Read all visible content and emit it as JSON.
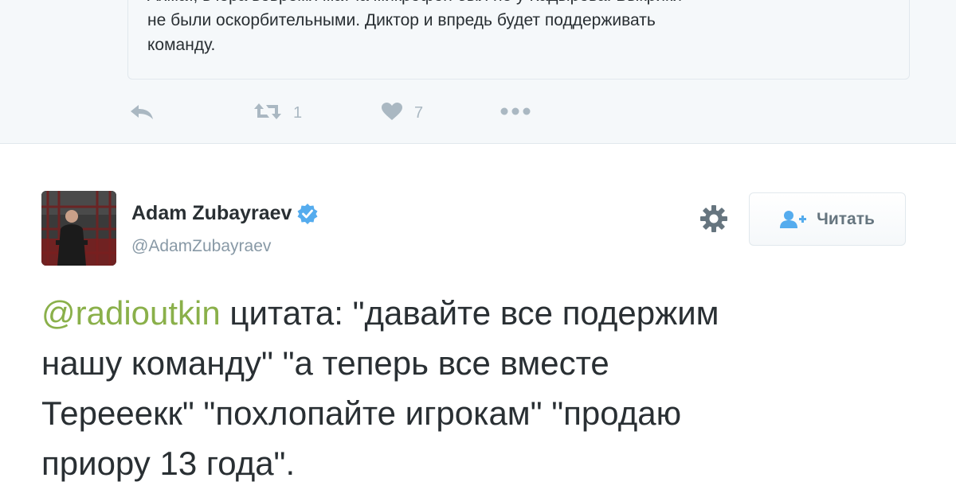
{
  "quoted": {
    "line1": "Ахмат, вчера вовремя матча микрофон был не у Кадырова. Выкрики",
    "line2": "не были оскорбительными. Диктор и впредь будет поддерживать",
    "line3": "команду.",
    "actions": {
      "reply_icon": "reply-icon",
      "retweet_icon": "retweet-icon",
      "retweet_count": "1",
      "like_icon": "heart-icon",
      "like_count": "7",
      "more_icon": "more-icon"
    }
  },
  "tweet": {
    "author_name": "Adam Zubayraev",
    "verified": true,
    "handle": "@AdamZubayraev",
    "follow_label": "Читать",
    "mention": "@radioutkin",
    "line1_rest": " цитата: \"давайте все подержим",
    "line2": "нашу команду\" \"а теперь все вместе",
    "line3": "Терееекк\" \"похлопайте игрокам\" \"продаю",
    "line4": "приору 13 года\"."
  },
  "colors": {
    "mention": "#8ab04a",
    "verified": "#55acee",
    "text": "#292f33",
    "muted": "#8899a6",
    "action": "#aab8c2"
  }
}
